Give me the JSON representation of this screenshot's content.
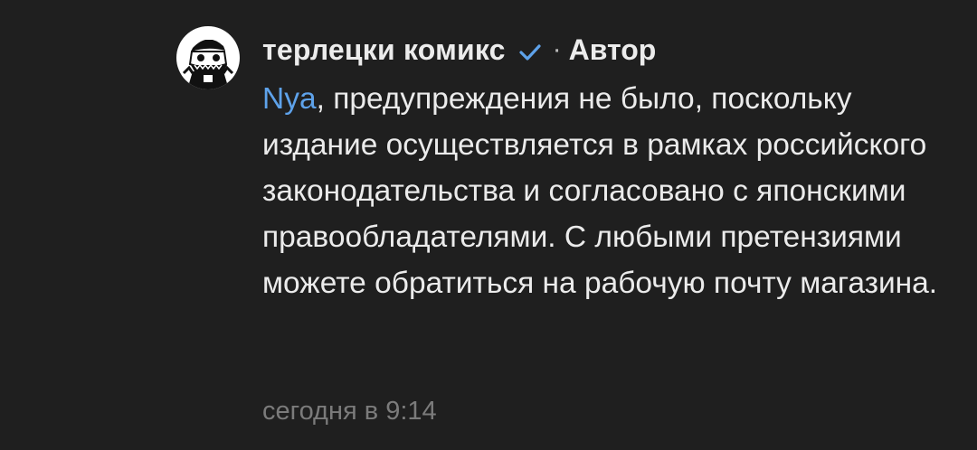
{
  "comment": {
    "author": {
      "name": "терлецки комикс",
      "verified_icon": "verified-check-icon",
      "separator": "·",
      "role": "Автор",
      "avatar_icon": "robot-mascot-avatar"
    },
    "mention": "Nya",
    "text": ", предупреждения не было, поскольку издание осуществляется в рамках российского законодательства и согласовано с японскими правообладателями. С любыми претензиями можете обратиться на рабочую почту магазина.",
    "timestamp": "сегодня в 9:14"
  },
  "colors": {
    "background": "#1f1f1f",
    "text": "#ebebeb",
    "mention": "#5ea2ea",
    "verified": "#5ea2ea",
    "timestamp": "#7b7b7b"
  }
}
